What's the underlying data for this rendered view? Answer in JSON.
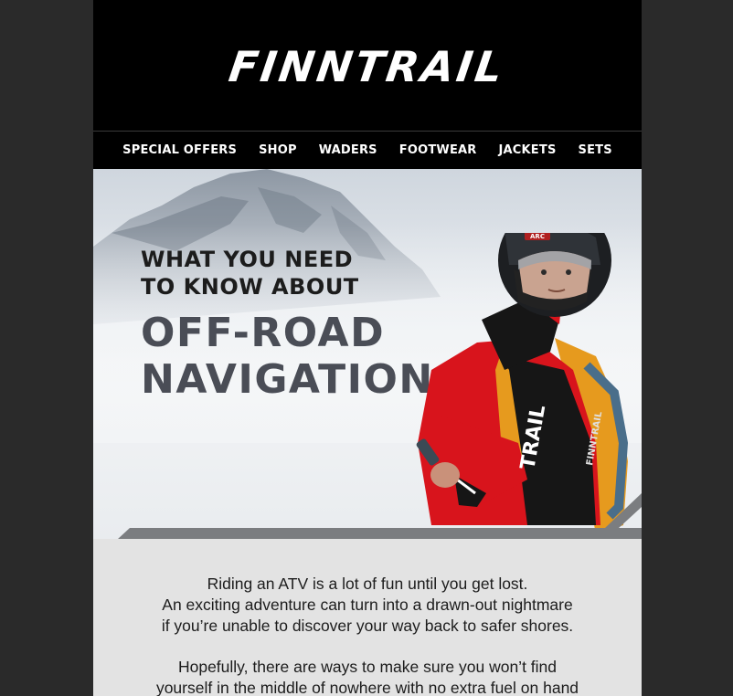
{
  "brand": {
    "logo": "FINNTRAIL"
  },
  "nav": {
    "items": [
      {
        "label": "SPECIAL OFFERS"
      },
      {
        "label": "SHOP"
      },
      {
        "label": "WADERS"
      },
      {
        "label": "FOOTWEAR"
      },
      {
        "label": "JACKETS"
      },
      {
        "label": "SETS"
      }
    ]
  },
  "hero": {
    "pretitle": "WHAT YOU NEED\nTO KNOW ABOUT",
    "title": "OFF-ROAD\nNAVIGATION",
    "jacket_brand": "FINNTRAIL",
    "sleeve_text": "TRAIL",
    "helmet_text": "ARC"
  },
  "body": {
    "paragraph1": "Riding an ATV is a lot of fun until you get lost.\nAn exciting adventure can turn into a drawn-out nightmare\nif you’re unable to discover your way back to safer shores.",
    "paragraph2": "Hopefully, there are ways to make sure you won’t find\nyourself in the middle of nowhere with no extra fuel on hand"
  },
  "colors": {
    "page_bg": "#2a2a2a",
    "header_bg": "#000000",
    "content_bg": "#e3e3e3",
    "title_gray": "#4a4d56",
    "jacket_red": "#d8141c",
    "backpack_orange": "#e69a1e"
  }
}
